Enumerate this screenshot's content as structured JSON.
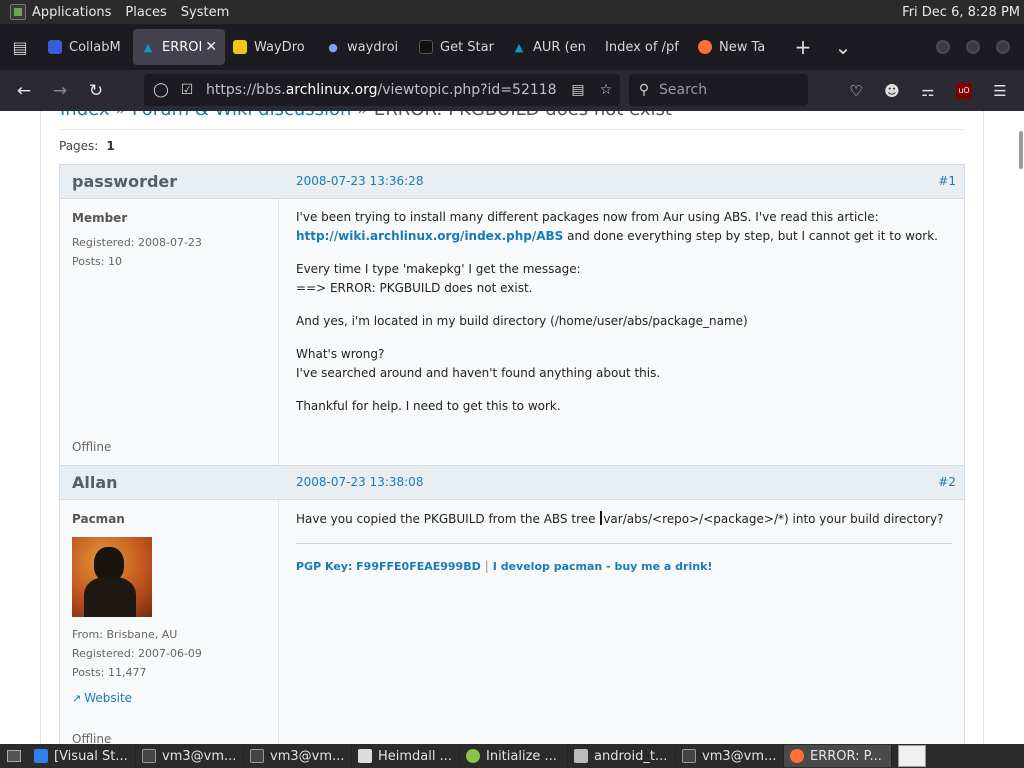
{
  "top_panel": {
    "menus": [
      "Applications",
      "Places",
      "System"
    ],
    "clock": "Fri Dec  6,  8:28 PM"
  },
  "tabs": [
    {
      "title": "CollabM",
      "icon": "collab-icon",
      "color": "#3b5bdb"
    },
    {
      "title": "ERROR",
      "icon": "archlinux-icon",
      "color": "#1793d1",
      "active": true
    },
    {
      "title": "WayDro",
      "icon": "waydroid-icon",
      "color": "#f5c518"
    },
    {
      "title": "waydroi",
      "icon": "waydroid-dot-icon",
      "color": "#6ea8ff"
    },
    {
      "title": "Get Star",
      "icon": "github-icon",
      "color": "#111111"
    },
    {
      "title": "AUR (en",
      "icon": "archlinux-icon",
      "color": "#1793d1"
    },
    {
      "title": "Index of /pf",
      "icon": "none"
    },
    {
      "title": "New Ta",
      "icon": "firefox-icon",
      "color": "#ff7139"
    }
  ],
  "url_bar": {
    "prefix": "https://bbs.",
    "host": "archlinux.org",
    "path": "/viewtopic.php?id=52118"
  },
  "search_bar": {
    "placeholder": "Search"
  },
  "breadcrumbs": {
    "index": "Index",
    "sep1": "»",
    "forum": "Forum & Wiki discussion",
    "sep2": "»",
    "current": "ERROR: PKGBUILD does not exist"
  },
  "pages": {
    "label": "Pages:",
    "current": "1"
  },
  "posts": [
    {
      "author": "passworder",
      "date": "2008-07-23 13:36:28",
      "number": "#1",
      "title": "Member",
      "info": [
        "Registered: 2008-07-23",
        "Posts: 10"
      ],
      "status": "Offline",
      "body": {
        "p1_text": "I've been trying to install many different packages now from Aur using ABS. I've read this article: ",
        "p1_link": "http://wiki.archlinux.org/index.php/ABS",
        "p1_tail": " and done everything step by step, but I cannot get it to work.",
        "p2_line1": "Every time I type 'makepkg' I get the message:",
        "p2_line2": "==> ERROR: PKGBUILD does not exist.",
        "p3": "And yes, i'm located in my build directory (/home/user/abs/package_name)",
        "p4_line1": "What's wrong?",
        "p4_line2": "I've searched around and haven't found anything about this.",
        "p5": "Thankful for help. I need to get this to work."
      }
    },
    {
      "author": "Allan",
      "date": "2008-07-23 13:38:08",
      "number": "#2",
      "title": "Pacman",
      "info": [
        "From: Brisbane, AU",
        "Registered: 2007-06-09",
        "Posts: 11,477"
      ],
      "website": "Website",
      "status": "Offline",
      "body": {
        "p1_before": "Have you copied the PKGBUILD from the ABS tree ",
        "p1_after": "var/abs/<repo>/<package>/*) into your build directory?",
        "sig_key": "PGP Key: F99FFE0FEAE999BD",
        "sig_sep": "|",
        "sig_link": "I develop pacman - buy me a drink!"
      }
    }
  ],
  "taskbar": [
    {
      "label": "[Visual St...",
      "icon": "vscode-icon",
      "color": "#2f80ed"
    },
    {
      "label": "vm3@vm...",
      "icon": "terminal-icon",
      "color": "#444444"
    },
    {
      "label": "vm3@vm...",
      "icon": "terminal-icon",
      "color": "#444444"
    },
    {
      "label": "Heimdall ...",
      "icon": "document-icon",
      "color": "#dddddd"
    },
    {
      "label": "Initialize ...",
      "icon": "android-icon",
      "color": "#8bc34a"
    },
    {
      "label": "android_t...",
      "icon": "folder-icon",
      "color": "#bbbbbb"
    },
    {
      "label": "vm3@vm...",
      "icon": "terminal-icon",
      "color": "#444444"
    },
    {
      "label": "ERROR: P...",
      "icon": "firefox-icon",
      "color": "#ff7139",
      "active": true
    }
  ]
}
